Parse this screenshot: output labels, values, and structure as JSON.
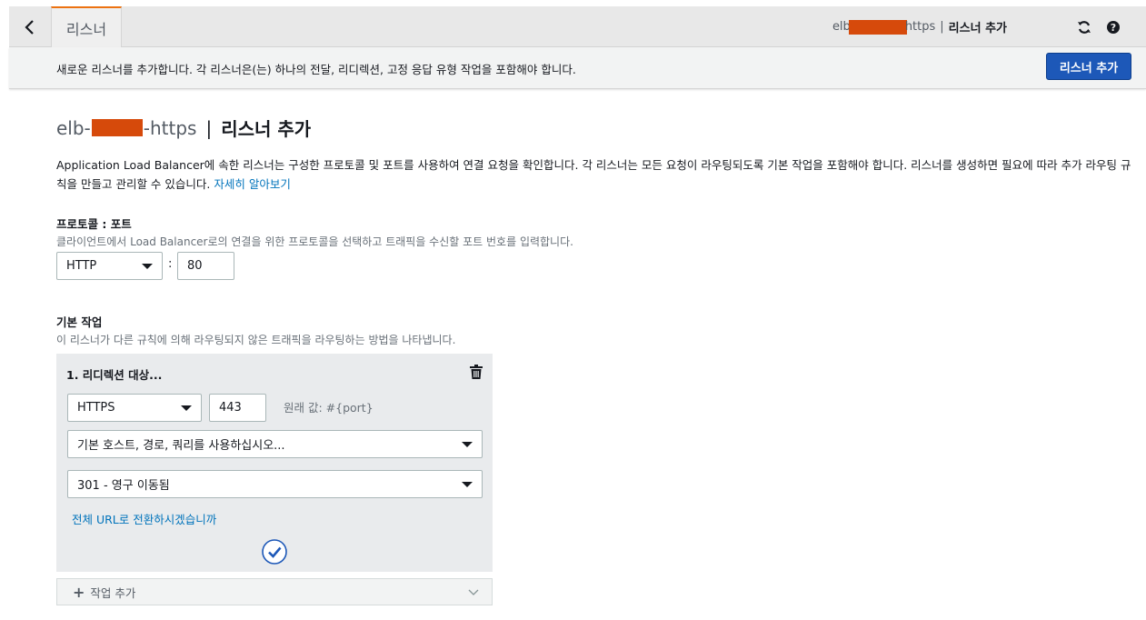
{
  "topbar": {
    "tab_label": "리스너",
    "crumb_prefix": "elb",
    "crumb_suffix": "https",
    "crumb_page": "리스너 추가",
    "icons": {
      "back": "chevron-left-icon",
      "refresh": "refresh-icon",
      "help": "help-icon"
    }
  },
  "infobar": {
    "message": "새로운 리스너를 추가합니다. 각 리스너은(는) 하나의 전달, 리디렉션, 고정 응답 유형 작업을 포함해야 합니다.",
    "add_button": "리스너 추가"
  },
  "page": {
    "title_prefix": "elb-",
    "title_suffix": "-https",
    "title_sep": "|",
    "title_page": "리스너 추가",
    "description": "Application Load Balancer에 속한 리스너는 구성한 프로토콜 및 포트를 사용하여 연결 요청을 확인합니다. 각 리스너는 모든 요청이 라우팅되도록 기본 작업을 포함해야 합니다. 리스너를 생성하면 필요에 따라 추가 라우팅 규칙을 만들고 관리할 수 있습니다.",
    "learn_more": "자세히 알아보기"
  },
  "protocol_port": {
    "label": "프로토콜 : 포트",
    "help": "클라이언트에서 Load Balancer로의 연결을 위한 프로토콜을 선택하고 트래픽을 수신할 포트 번호를 입력합니다.",
    "protocol": "HTTP",
    "colon": ":",
    "port": "80"
  },
  "default_action": {
    "label": "기본 작업",
    "help": "이 리스너가 다른 규칙에 의해 라우팅되지 않은 트래픽을 라우팅하는 방법을 나타냅니다.",
    "action_title": "1. 리디렉션 대상...",
    "protocol": "HTTPS",
    "port": "443",
    "original_value": "원래 값: #{port}",
    "host_path_query": "기본 호스트, 경로, 쿼리를 사용하십시오...",
    "status_code": "301 - 영구 이동됨",
    "full_url_link": "전체 URL로 전환하시겠습니까",
    "add_action": "작업 추가"
  },
  "colors": {
    "accent_orange": "#ec7211",
    "primary_blue": "#1d58b8",
    "link_blue": "#0073bb",
    "redaction": "#d64a0b"
  }
}
